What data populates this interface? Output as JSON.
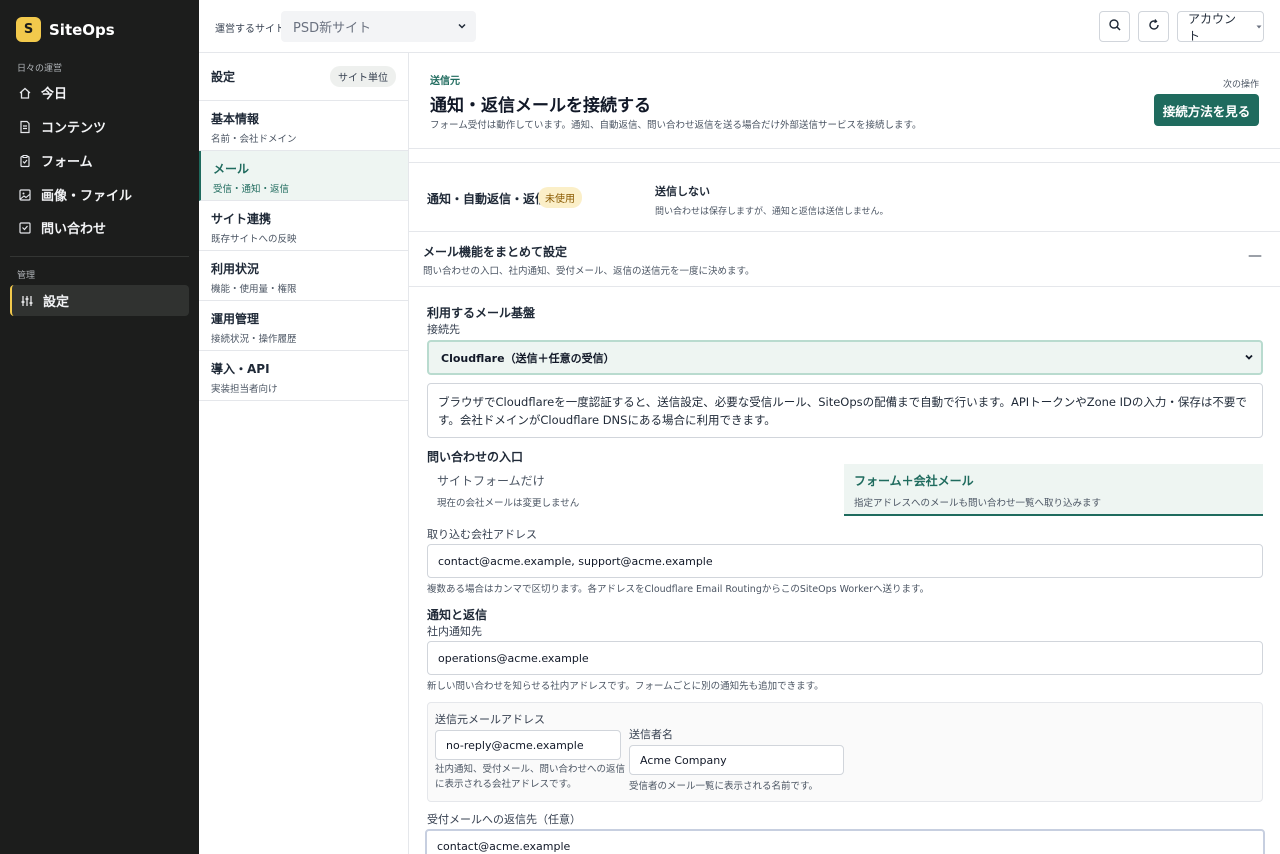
{
  "brand": {
    "logo_letter": "S",
    "name": "SiteOps",
    "accent": "#f2c94c"
  },
  "sidebar": {
    "section_daily": "日々の運営",
    "items": [
      {
        "label": "今日",
        "icon": "home-icon"
      },
      {
        "label": "コンテンツ",
        "icon": "document-icon"
      },
      {
        "label": "フォーム",
        "icon": "clipboard-icon"
      },
      {
        "label": "画像・ファイル",
        "icon": "image-icon"
      },
      {
        "label": "問い合わせ",
        "icon": "inbox-icon"
      }
    ],
    "section_admin": "管理",
    "admin_items": [
      {
        "label": "設定",
        "icon": "sliders-icon",
        "active": true
      }
    ]
  },
  "topbar": {
    "site_label": "運営するサイト",
    "site_value": "PSD新サイト",
    "account_label": "アカウント"
  },
  "settings_nav": {
    "title": "設定",
    "badge": "サイト単位",
    "items": [
      {
        "title": "基本情報",
        "sub": "名前・会社ドメイン"
      },
      {
        "title": "メール",
        "sub": "受信・通知・返信",
        "active": true
      },
      {
        "title": "サイト連携",
        "sub": "既存サイトへの反映"
      },
      {
        "title": "利用状況",
        "sub": "機能・使用量・権限"
      },
      {
        "title": "運用管理",
        "sub": "接続状況・操作履歴"
      },
      {
        "title": "導入・API",
        "sub": "実装担当者向け"
      }
    ]
  },
  "hero": {
    "eyebrow": "送信元",
    "title": "通知・返信メールを接続する",
    "description": "フォーム受付は動作しています。通知、自動返信、問い合わせ返信を送る場合だけ外部送信サービスを接続します。",
    "next_label": "次の操作",
    "button": "接続方法を見る",
    "accent": "#1f6b5e"
  },
  "status": {
    "label": "通知・自動返信・返信",
    "badge": "未使用",
    "title": "送信しない",
    "sub": "問い合わせは保存しますが、通知と返信は送信しません。"
  },
  "accordion": {
    "title": "メール機能をまとめて設定",
    "sub": "問い合わせの入口、社内通知、受付メール、返信の送信元を一度に決めます。",
    "toggle": "—"
  },
  "form": {
    "platform_label": "利用するメール基盤",
    "connect_label": "接続先",
    "connect_value": "Cloudflare（送信＋任意の受信）",
    "info": "ブラウザでCloudflareを一度認証すると、送信設定、必要な受信ルール、SiteOpsの配備まで自動で行います。APIトークンやZone IDの入力・保存は不要です。会社ドメインがCloudflare DNSにある場合に利用できます。",
    "entry_label": "問い合わせの入口",
    "entry_options": [
      {
        "title": "サイトフォームだけ",
        "sub": "現在の会社メールは変更しません"
      },
      {
        "title": "フォーム＋会社メール",
        "sub": "指定アドレスへのメールも問い合わせ一覧へ取り込みます",
        "active": true
      }
    ],
    "import_label": "取り込む会社アドレス",
    "import_value": "contact@acme.example, support@acme.example",
    "import_help": "複数ある場合はカンマで区切ります。各アドレスをCloudflare Email RoutingからこのSiteOps Workerへ送ります。",
    "notify_section": "通知と返信",
    "notify_label": "社内通知先",
    "notify_value": "operations@acme.example",
    "notify_help": "新しい問い合わせを知らせる社内アドレスです。フォームごとに別の通知先も追加できます。",
    "sender_label": "送信元メールアドレス",
    "sender_value": "no-reply@acme.example",
    "sender_help": "社内通知、受付メール、問い合わせへの返信に表示される会社アドレスです。",
    "sender_name_label": "送信者名",
    "sender_name_value": "Acme Company",
    "sender_name_help": "受信者のメール一覧に表示される名前です。",
    "replyto_label": "受付メールへの返信先（任意）",
    "replyto_value": "contact@acme.example"
  }
}
